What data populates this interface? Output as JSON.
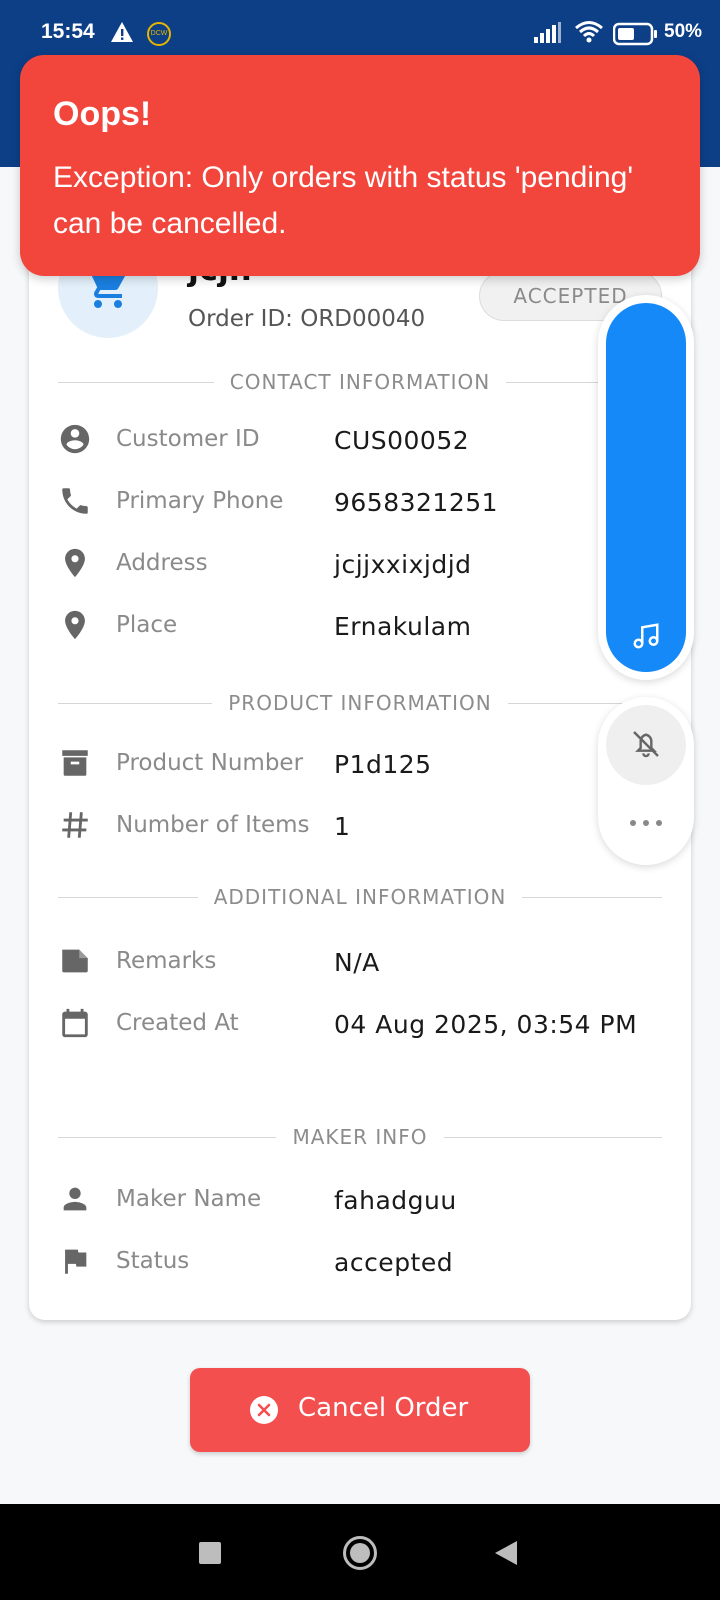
{
  "status_bar": {
    "time": "15:54",
    "badge_text": "DCW",
    "battery": "50%"
  },
  "order": {
    "customer_name": "jcjn",
    "order_id": "Order ID: ORD00040",
    "status_pill": "ACCEPTED"
  },
  "sections": {
    "contact": "CONTACT INFORMATION",
    "product": "PRODUCT INFORMATION",
    "additional": "ADDITIONAL INFORMATION",
    "maker": "MAKER INFO"
  },
  "fields": {
    "customer_id": {
      "label": "Customer ID",
      "value": "CUS00052"
    },
    "primary_phone": {
      "label": "Primary Phone",
      "value": "9658321251"
    },
    "address": {
      "label": "Address",
      "value": "jcjjxxixjdjd"
    },
    "place": {
      "label": "Place",
      "value": "Ernakulam"
    },
    "product_number": {
      "label": "Product Number",
      "value": "P1d125"
    },
    "number_of_items": {
      "label": "Number of Items",
      "value": "1"
    },
    "remarks": {
      "label": "Remarks",
      "value": "N/A"
    },
    "created_at": {
      "label": "Created At",
      "value": "04 Aug 2025, 03:54 PM"
    },
    "maker_name": {
      "label": "Maker Name",
      "value": "fahadguu"
    },
    "status": {
      "label": "Status",
      "value": "accepted"
    }
  },
  "actions": {
    "cancel_label": "Cancel Order"
  },
  "toast": {
    "title": "Oops!",
    "message": "Exception: Only orders with status 'pending' can be cancelled."
  },
  "colors": {
    "header": "#0d3f87",
    "toast": "#f2463c",
    "cancel": "#f44f4f",
    "float_pill": "#1589f7"
  },
  "icons": [
    "warning-icon",
    "signal-icon",
    "wifi-icon",
    "battery-icon",
    "cart-icon",
    "account-circle-icon",
    "phone-icon",
    "location-pin-icon",
    "archive-box-icon",
    "hash-icon",
    "note-icon",
    "calendar-icon",
    "person-icon",
    "flag-icon",
    "close-circle-icon",
    "music-note-icon",
    "bell-off-icon",
    "more-horizontal-icon",
    "nav-recents-icon",
    "nav-home-icon",
    "nav-back-icon"
  ]
}
